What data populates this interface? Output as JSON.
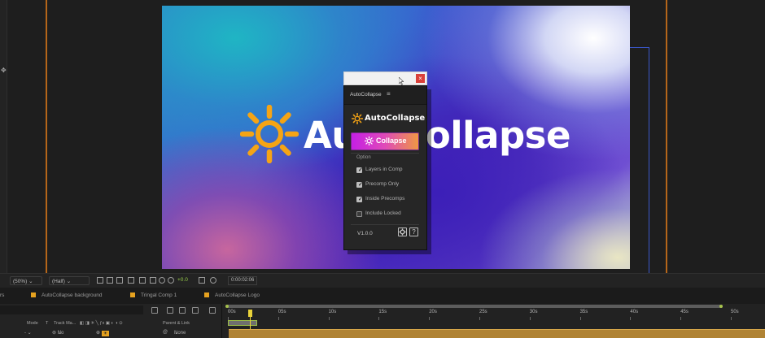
{
  "composition": {
    "title_text": "AutoCollapse"
  },
  "floating_window": {
    "close_glyph": "×"
  },
  "panel": {
    "tab_label": "AutoCollapse",
    "menu_glyph": "≡",
    "brand_text": "AutoCollapse",
    "collapse_label": "Collapse",
    "collapse_gradient": [
      "#c41ee6",
      "#f09a40"
    ],
    "option_title": "Option",
    "options": [
      {
        "label": "Layers in Comp",
        "checked": true
      },
      {
        "label": "Precomp Only",
        "checked": true
      },
      {
        "label": "Inside Precomps",
        "checked": true
      },
      {
        "label": "Include Locked",
        "checked": false
      }
    ],
    "version": "V1.0.0",
    "settings_icon": "gear-icon",
    "help_glyph": "?"
  },
  "viewer_toolbar": {
    "zoom": "(50%)",
    "resolution": "(Half)",
    "exposure": "+0.0",
    "timecode": "0:00:02:06"
  },
  "comp_tabs": [
    {
      "label": "rs"
    },
    {
      "label": "AutoCollapse background",
      "color": "#e6a21f"
    },
    {
      "label": "Tringal Comp 1",
      "color": "#e6a21f"
    },
    {
      "label": "AutoCollapse Logo",
      "color": "#e6a21f"
    }
  ],
  "timeline": {
    "columns": {
      "mode": "Mode",
      "t": "T",
      "track_matte": "Track Ma...",
      "parent_link": "Parent & Link"
    },
    "row": {
      "trackmatte_value": "No",
      "parent_value": "None"
    },
    "ruler_labels": [
      "00s",
      "05s",
      "10s",
      "15s",
      "20s",
      "25s",
      "30s",
      "35s",
      "40s",
      "45s",
      "50s"
    ],
    "ruler_max_seconds": 50,
    "work_area_end_seconds": 49,
    "playhead_seconds": 2.3
  }
}
